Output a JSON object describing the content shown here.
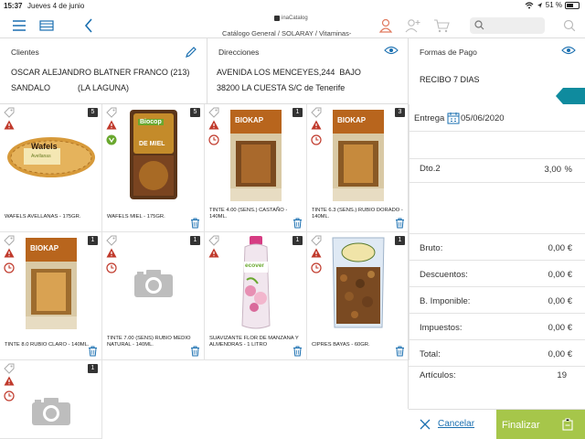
{
  "status": {
    "time": "15:37",
    "date": "Jueves 4 de junio",
    "battery": "51 %"
  },
  "toolbar": {
    "logo": "inaCatalog",
    "path": "Catálogo General / SOLARAY / Vitaminas-"
  },
  "clientes": {
    "label": "Clientes",
    "line1": "OSCAR ALEJANDRO BLATNER FRANCO (213)",
    "line2": "SANDALO            (LA LAGUNA)"
  },
  "direcciones": {
    "label": "Direcciones",
    "line1": "AVENIDA LOS MENCEYES,244  BAJO",
    "line2": "38200 LA CUESTA S/C de Tenerife"
  },
  "pago": {
    "label": "Formas de Pago",
    "value": "RECIBO 7 DIAS"
  },
  "entrega": {
    "label": "Entrega",
    "date": "05/06/2020"
  },
  "dto": {
    "label": "Dto.2",
    "value": "3,00",
    "unit": "%"
  },
  "totals": {
    "bruto": {
      "label": "Bruto:",
      "value": "0,00 €"
    },
    "descuentos": {
      "label": "Descuentos:",
      "value": "0,00 €"
    },
    "imponible": {
      "label": "B. Imponible:",
      "value": "0,00 €"
    },
    "impuestos": {
      "label": "Impuestos:",
      "value": "0,00 €"
    },
    "total": {
      "label": "Total:",
      "value": "0,00 €"
    },
    "articulos": {
      "label": "Artículos:",
      "value": "19"
    }
  },
  "actions": {
    "cancel": "Cancelar",
    "finalize": "Finalizar"
  },
  "products": [
    {
      "name": "WAFELS AVELLANAS - 175GR.",
      "qty": "5"
    },
    {
      "name": "WAFELS MIEL - 175GR.",
      "qty": "5"
    },
    {
      "name": "TINTE 4.00 (SENS.) CASTAÑO - 140ML.",
      "qty": "1"
    },
    {
      "name": "TINTE 6.3 (SENS.) RUBIO DORADO - 140ML.",
      "qty": "3"
    },
    {
      "name": "TINTE 8.0 RUBIO CLARO - 140ML.",
      "qty": "1"
    },
    {
      "name": "TINTE 7.00 (SENS) RUBIO MEDIO NATURAL - 140ML.",
      "qty": "1"
    },
    {
      "name": "SUAVIZANTE FLOR DE MANZANA Y ALMENDRAS - 1 LITRO",
      "qty": "1"
    },
    {
      "name": "CIPRES BAYAS - 60GR.",
      "qty": "1"
    },
    {
      "name": "",
      "qty": "1"
    }
  ],
  "product_images": {
    "p0_brand": "Wafels",
    "p0_sub": "Avellanas",
    "p1_brand": "Biocop",
    "p1_sub": "DE MIEL",
    "biokap": "BIOKAP",
    "ecover": "ecover"
  },
  "colors": {
    "accent": "#1a6fb0",
    "finalize": "#a6c64a",
    "teal": "#0f8b9e",
    "warn": "#c0392b"
  }
}
